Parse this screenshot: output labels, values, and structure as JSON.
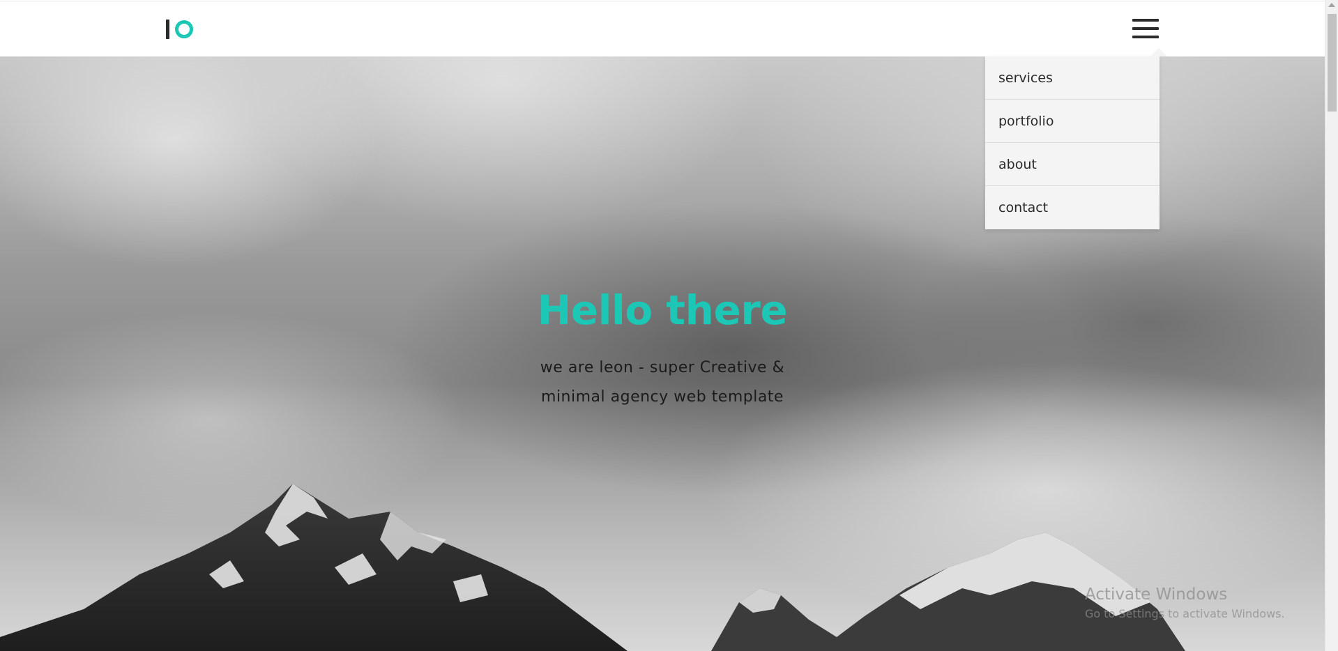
{
  "header": {
    "logo_icon": "io-logo-icon",
    "menu_icon": "hamburger-menu-icon"
  },
  "menu": {
    "items": [
      {
        "label": "services"
      },
      {
        "label": "portfolio"
      },
      {
        "label": "about"
      },
      {
        "label": "contact"
      }
    ]
  },
  "hero": {
    "title": "Hello there",
    "subtitle_line1": "we are leon - super Creative &",
    "subtitle_line2": "minimal agency web template",
    "background_icon": "cloudy-mountains-photo"
  },
  "watermark": {
    "title": "Activate Windows",
    "subtitle": "Go to Settings to activate Windows."
  },
  "colors": {
    "accent": "#1cc7b6",
    "header_bg": "#ffffff",
    "menu_bg": "#f4f4f4",
    "text_dark": "#2a2a2a"
  }
}
